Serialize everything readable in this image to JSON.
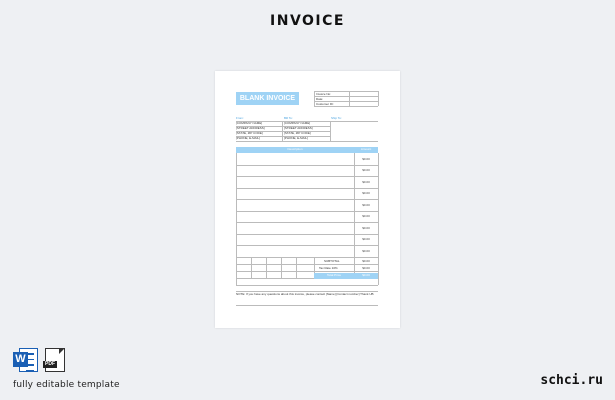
{
  "page": {
    "title": "INVOICE"
  },
  "invoice": {
    "title": "BLANK INVOICE",
    "meta": [
      "Invoice No:",
      "Date:",
      "Customer ID:"
    ],
    "from_label": "From:",
    "to_label": "Bill To:",
    "ship_label": "Ship To:",
    "from_lines": [
      "[COMPANY NAME]",
      "[STREET ADDRESS]",
      "[STATE, ZIP CODE]",
      "[PHONE, E-MAIL]"
    ],
    "to_lines": [
      "[COMPANY NAME]",
      "[STREET ADDRESS]",
      "[STATE, ZIP CODE]",
      "[PHONE, E-MAIL]"
    ],
    "col_description": "Description",
    "col_amount": "Amount",
    "amounts": [
      "$0.00",
      "$0.00",
      "$0.00",
      "$0.00",
      "$0.00",
      "$0.00",
      "$0.00",
      "$0.00",
      "$0.00"
    ],
    "subtotal_label": "SUBTOTAL",
    "subtotal_value": "$0.00",
    "tax_label": "Tax Rate 10%",
    "tax_value": "$0.00",
    "total_label": "Total Price",
    "total_value": "$0.00",
    "note": "NOTE: If you have any questions about this invoice, please contact [Name] [Contact number] Thank UB"
  },
  "footer": {
    "caption": "fully editable template",
    "brand": "schci.ru"
  },
  "icons": {
    "word": "word-icon",
    "pdf": "pdf-icon",
    "pdf_text": "PDF",
    "word_text": "W"
  }
}
